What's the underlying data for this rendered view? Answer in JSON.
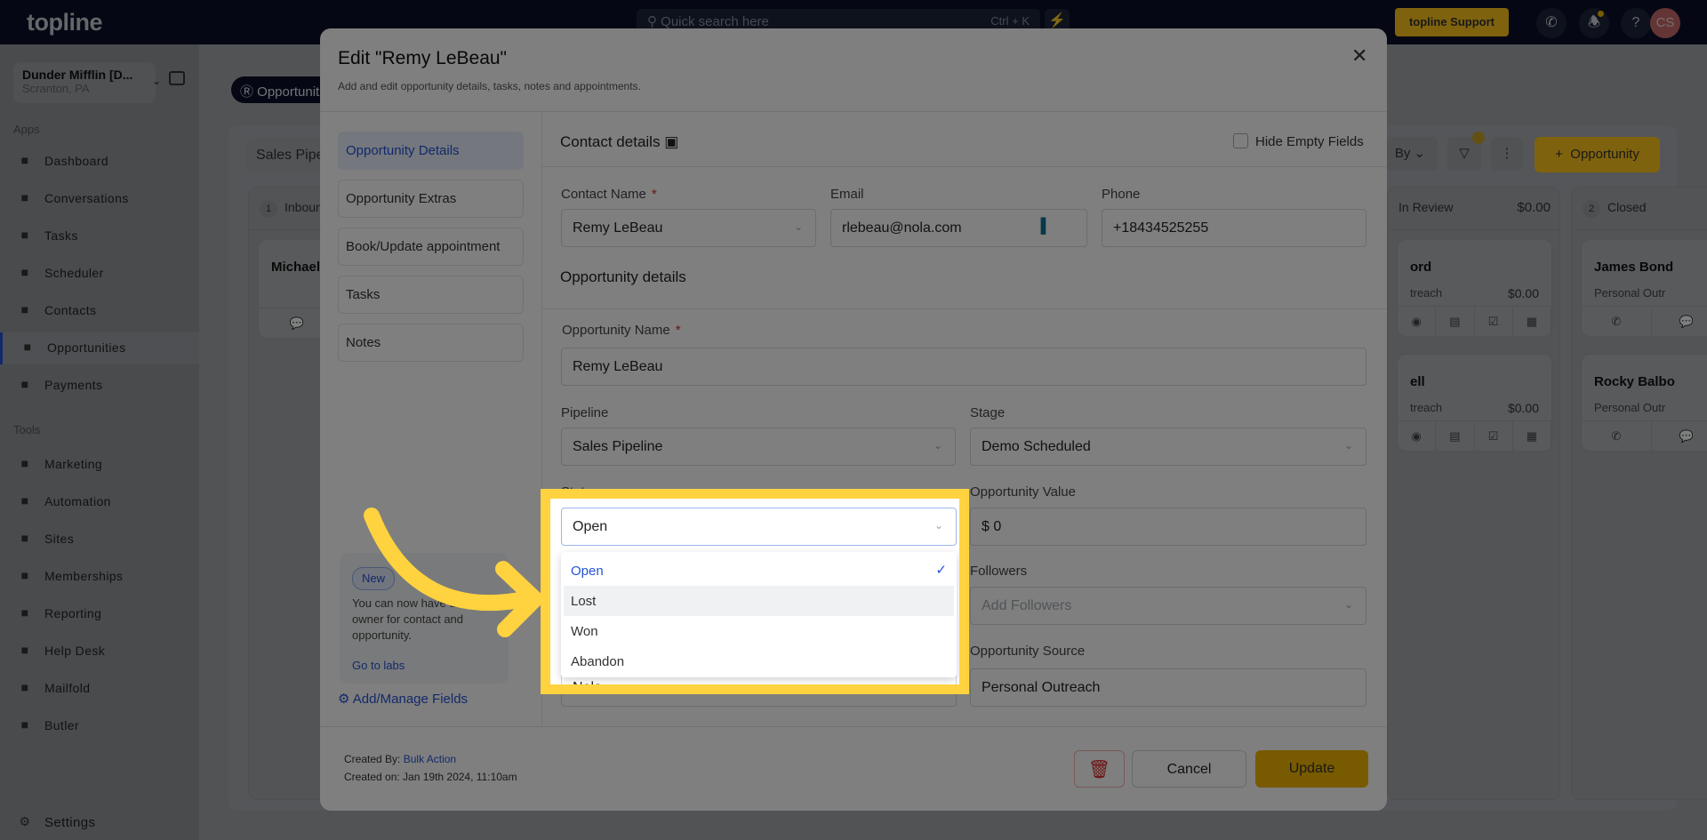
{
  "topbar": {
    "logo": "topline",
    "search_placeholder": "Quick search here",
    "search_shortcut": "Ctrl + K",
    "support_label": "topline Support",
    "avatar_initials": "CS",
    "notification_dot_color": "#f0b400"
  },
  "sidebar": {
    "company_name": "Dunder Mifflin [D...",
    "company_location": "Scranton, PA",
    "apps_label": "Apps",
    "apps": [
      {
        "label": "Dashboard",
        "icon": "dashboard-icon"
      },
      {
        "label": "Conversations",
        "icon": "chat-icon"
      },
      {
        "label": "Tasks",
        "icon": "task-icon"
      },
      {
        "label": "Scheduler",
        "icon": "calendar-icon"
      },
      {
        "label": "Contacts",
        "icon": "user-icon"
      },
      {
        "label": "Opportunities",
        "icon": "target-icon",
        "active": true
      },
      {
        "label": "Payments",
        "icon": "card-icon"
      }
    ],
    "tools_label": "Tools",
    "tools": [
      {
        "label": "Marketing",
        "icon": "megaphone-icon"
      },
      {
        "label": "Automation",
        "icon": "gears-icon"
      },
      {
        "label": "Sites",
        "icon": "globe-icon"
      },
      {
        "label": "Memberships",
        "icon": "users-icon"
      },
      {
        "label": "Reporting",
        "icon": "pie-icon"
      },
      {
        "label": "Help Desk",
        "icon": "help-icon"
      },
      {
        "label": "Mailfold",
        "icon": "mail-icon"
      },
      {
        "label": "Butler",
        "icon": "bell-cloche-icon"
      }
    ],
    "settings": "Settings"
  },
  "background": {
    "tab": "Opportunities",
    "pipeline": "Sales Pipe",
    "sort_label": "By",
    "add_label": "Opportunity",
    "columns": [
      {
        "count": "1",
        "name": "Inbound",
        "cards": [
          {
            "name": "Michael S"
          }
        ]
      },
      {
        "name": "In Review",
        "total": "$0.00",
        "cards": [
          {
            "name": "ord",
            "source": "treach",
            "value": "$0.00"
          },
          {
            "name": "ell",
            "source": "treach",
            "value": "$0.00"
          }
        ]
      },
      {
        "count": "2",
        "name": "Closed",
        "cards": [
          {
            "name": "James Bond",
            "source": "Personal Outr"
          },
          {
            "name": "Rocky Balbo",
            "source": "Personal Outr"
          }
        ]
      }
    ]
  },
  "modal": {
    "title": "Edit \"Remy LeBeau\"",
    "subtitle": "Add and edit opportunity details, tasks, notes and appointments.",
    "nav": [
      "Opportunity Details",
      "Opportunity Extras",
      "Book/Update appointment",
      "Tasks",
      "Notes"
    ],
    "new_badge": "New",
    "new_text": "You can now have different owner for contact and opportunity.",
    "go_to_labs": "Go to labs",
    "manage_fields": "Add/Manage Fields",
    "contact_section": "Contact details",
    "hide_empty": "Hide Empty Fields",
    "contact_name_label": "Contact Name",
    "contact_name": "Remy LeBeau",
    "email_label": "Email",
    "email": "rlebeau@nola.com",
    "phone_label": "Phone",
    "phone": "+18434525255",
    "opp_section": "Opportunity details",
    "opp_name_label": "Opportunity Name",
    "opp_name": "Remy LeBeau",
    "pipeline_label": "Pipeline",
    "pipeline": "Sales Pipeline",
    "stage_label": "Stage",
    "stage": "Demo Scheduled",
    "status_label": "Status",
    "status": "Open",
    "status_options": [
      "Open",
      "Lost",
      "Won",
      "Abandon"
    ],
    "value_label": "Opportunity Value",
    "value": "$ 0",
    "followers_label": "Followers",
    "followers_placeholder": "Add Followers",
    "source_label": "Opportunity Source",
    "source": "Personal Outreach",
    "lead_source": "Nola",
    "created_by_label": "Created By:",
    "created_by": "Bulk Action",
    "created_on": "Created on: Jan 19th 2024, 11:10am",
    "cancel": "Cancel",
    "update": "Update"
  },
  "highlight_color": "#ffd23f",
  "accent_color": "#2453d6"
}
